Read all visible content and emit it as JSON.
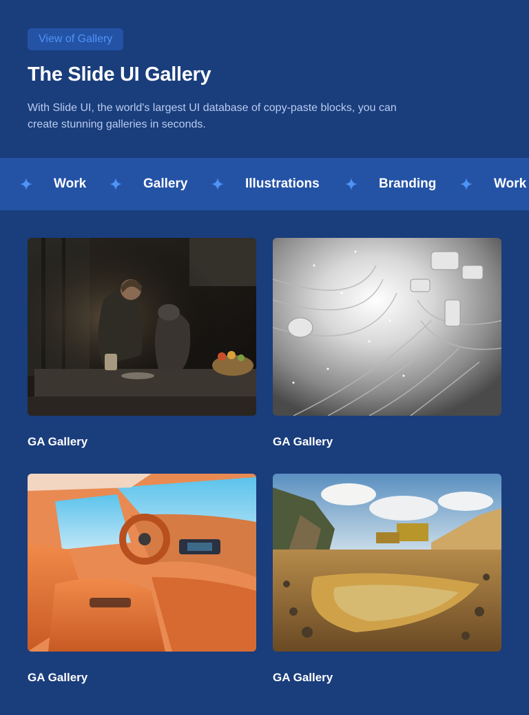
{
  "hero": {
    "badge_label": "View of Gallery",
    "title": "The Slide UI Gallery",
    "subtitle": "With Slide UI, the world's largest UI database of copy-paste blocks, you can create stunning galleries in seconds."
  },
  "marquee": {
    "items": [
      "Work",
      "Gallery",
      "Illustrations",
      "Branding",
      "Work"
    ],
    "separator_icon": "sparkle-icon"
  },
  "gallery": {
    "cards": [
      {
        "label": "GA Gallery",
        "image": "man-with-dog-photo"
      },
      {
        "label": "GA Gallery",
        "image": "abstract-tech-tunnel-photo"
      },
      {
        "label": "GA Gallery",
        "image": "car-interior-photo"
      },
      {
        "label": "GA Gallery",
        "image": "quarry-landscape-photo"
      }
    ]
  },
  "colors": {
    "background": "#1a3d7c",
    "band": "#2453a6",
    "accent": "#4f93f5",
    "text": "#ffffff",
    "muted_text": "#b9cdf0"
  }
}
